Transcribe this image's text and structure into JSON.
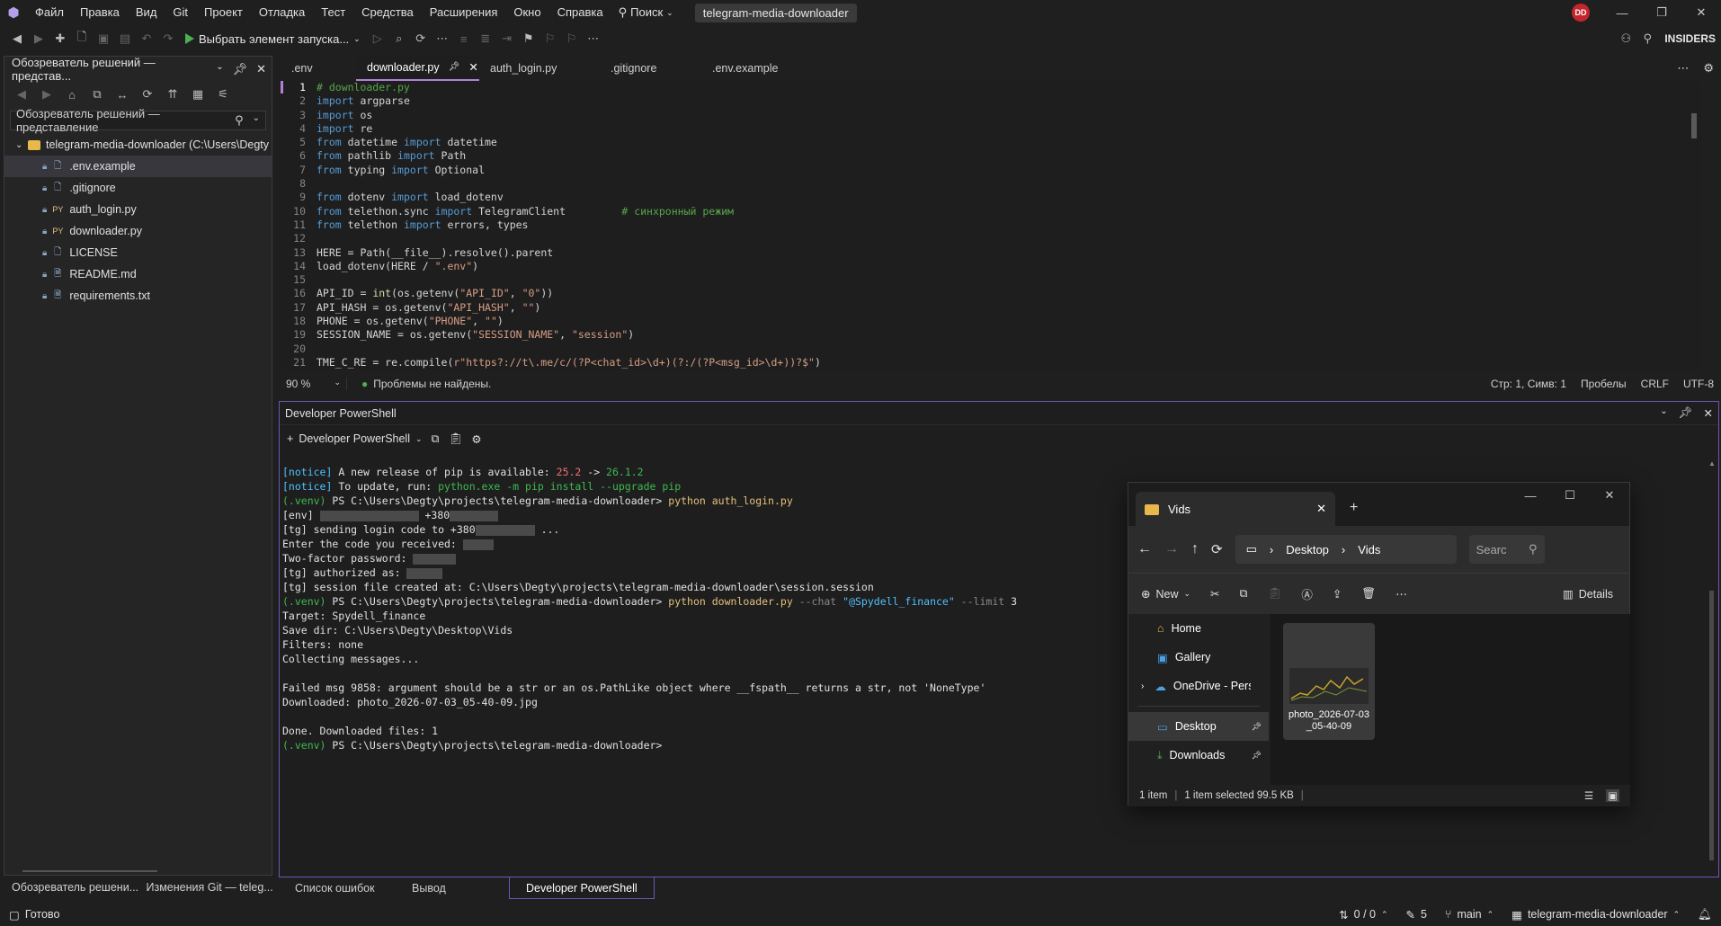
{
  "menubar": {
    "items": [
      "Файл",
      "Правка",
      "Вид",
      "Git",
      "Проект",
      "Отладка",
      "Тест",
      "Средства",
      "Расширения",
      "Окно",
      "Справка"
    ],
    "search": "Поиск",
    "title": "telegram-media-downloader",
    "avatar": "DD"
  },
  "toolbar": {
    "run_label": "Выбрать элемент запуска...",
    "insiders": "INSIDERS"
  },
  "solution_explorer": {
    "title": "Обозреватель решений — представ...",
    "search_placeholder": "Обозреватель решений — представление",
    "root": "telegram-media-downloader (C:\\Users\\Degty",
    "files": [
      {
        "name": ".env.example",
        "type": "doc"
      },
      {
        "name": ".gitignore",
        "type": "doc"
      },
      {
        "name": "auth_login.py",
        "type": "PY"
      },
      {
        "name": "downloader.py",
        "type": "PY"
      },
      {
        "name": "LICENSE",
        "type": "doc"
      },
      {
        "name": "README.md",
        "type": "md"
      },
      {
        "name": "requirements.txt",
        "type": "doc"
      }
    ],
    "bottom_tabs": [
      "Обозреватель решени...",
      "Изменения Git — teleg..."
    ]
  },
  "editor": {
    "tabs": [
      ".env",
      "downloader.py",
      "auth_login.py",
      ".gitignore",
      ".env.example"
    ],
    "active_tab": "downloader.py",
    "zoom": "90 %",
    "problems": "Проблемы не найдены.",
    "position": "Стр: 1, Симв: 1",
    "whitespace": "Пробелы",
    "eol": "CRLF",
    "encoding": "UTF-8"
  },
  "code": [
    "# downloader.py",
    "import argparse",
    "import os",
    "import re",
    "from datetime import datetime",
    "from pathlib import Path",
    "from typing import Optional",
    "",
    "from dotenv import load_dotenv",
    "from telethon.sync import TelegramClient         # синхронный режим",
    "from telethon import errors, types",
    "",
    "HERE = Path(__file__).resolve().parent",
    "load_dotenv(HERE / \".env\")",
    "",
    "API_ID = int(os.getenv(\"API_ID\", \"0\"))",
    "API_HASH = os.getenv(\"API_HASH\", \"\")",
    "PHONE = os.getenv(\"PHONE\", \"\")",
    "SESSION_NAME = os.getenv(\"SESSION_NAME\", \"session\")",
    "",
    "TME_C_RE = re.compile(r\"https?://t\\.me/c/(?P<chat_id>\\d+)(?:/(?P<msg_id>\\d+))?$\")"
  ],
  "terminal": {
    "title": "Developer PowerShell",
    "profile": "Developer PowerShell",
    "lines": {
      "l1a": "[notice]",
      "l1b": " A new release of pip is available: ",
      "l1c": "25.2",
      "l1d": " -> ",
      "l1e": "26.1.2",
      "l2a": "[notice]",
      "l2b": " To update, run: ",
      "l2c": "python.exe -m pip install --upgrade pip",
      "l3a": "(.venv)",
      "l3b": " PS C:\\Users\\Degty\\projects\\telegram-media-downloader> ",
      "l3c": "python auth_login.py",
      "l4a": "[env] ",
      "l4b": " +380",
      "l5a": "[tg] sending login code to +380",
      "l5b": " ...",
      "l6": "Enter the code you received: ",
      "l7": "Two-factor password: ",
      "l8": "[tg] authorized as: ",
      "l9": "[tg] session file created at: C:\\Users\\Degty\\projects\\telegram-media-downloader\\session.session",
      "l10a": "(.venv)",
      "l10b": " PS C:\\Users\\Degty\\projects\\telegram-media-downloader> ",
      "l10c": "python downloader.py",
      "l10d": " --chat ",
      "l10e": "\"@Spydell_finance\"",
      "l10f": " --limit ",
      "l10g": "3",
      "l11": "Target: Spydell_finance",
      "l12": "Save dir: C:\\Users\\Degty\\Desktop\\Vids",
      "l13": "Filters: none",
      "l14": "Collecting messages...",
      "l15": "Failed msg 9858: argument should be a str or an os.PathLike object where __fspath__ returns a str, not 'NoneType'",
      "l16": "Downloaded: photo_2026-07-03_05-40-09.jpg",
      "l17": "Done. Downloaded files: 1",
      "l18a": "(.venv)",
      "l18b": " PS C:\\Users\\Degty\\projects\\telegram-media-downloader>"
    },
    "tabs": [
      "Список ошибок",
      "Вывод",
      "Developer PowerShell"
    ]
  },
  "file_explorer": {
    "tab_title": "Vids",
    "breadcrumb": [
      "Desktop",
      "Vids"
    ],
    "search_placeholder": "Searc",
    "new_label": "New",
    "details_label": "Details",
    "sidebar": [
      "Home",
      "Gallery",
      "OneDrive - Perso",
      "Desktop",
      "Downloads"
    ],
    "file_name": "photo_2026-07-03_05-40-09",
    "status": {
      "count": "1 item",
      "selected": "1 item selected  99.5 KB"
    }
  },
  "statusbar": {
    "ready": "Готово",
    "git_sync": "0 / 0",
    "changes": "5",
    "branch": "main",
    "repo": "telegram-media-downloader"
  }
}
